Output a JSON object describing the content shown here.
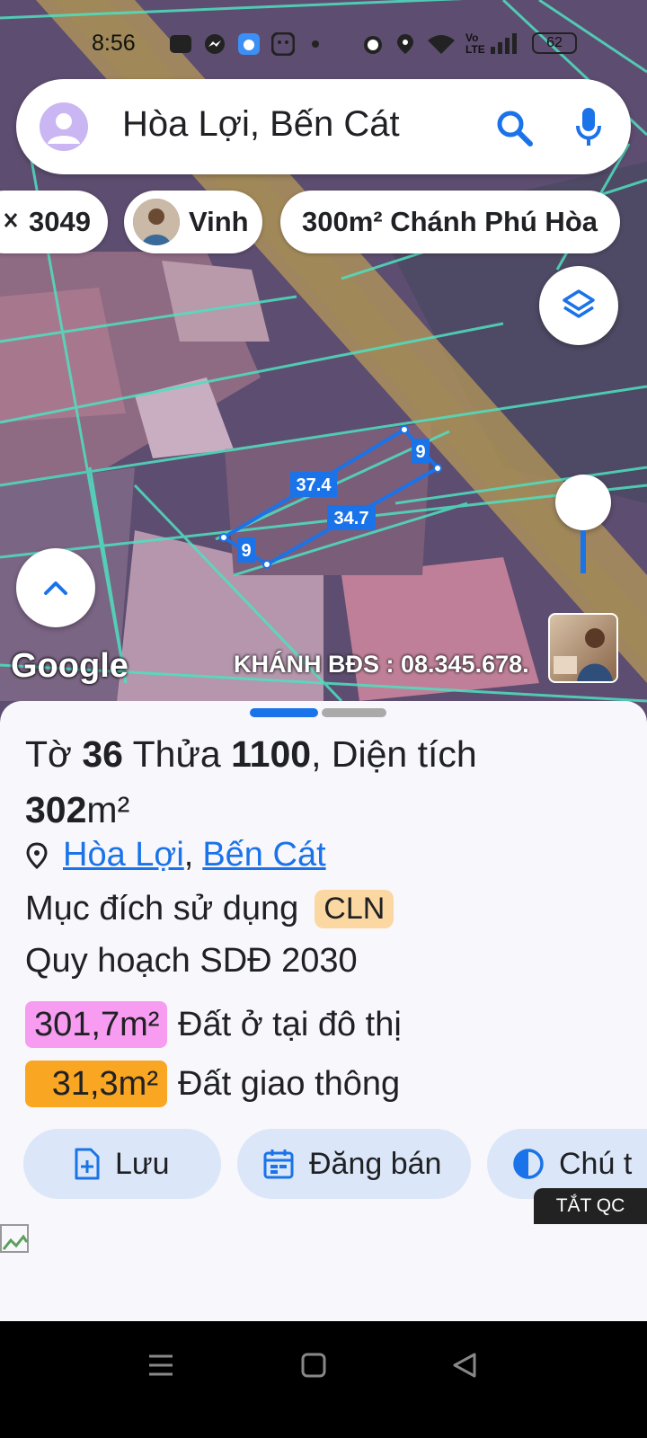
{
  "status_bar": {
    "time": "8:56",
    "battery": "62",
    "network": "Vo LTE"
  },
  "search": {
    "value": "Hòa Lợi, Bến Cát"
  },
  "chips": [
    {
      "label": "3049"
    },
    {
      "label": "Vinh"
    },
    {
      "label": "300m² Chánh Phú Hòa"
    }
  ],
  "map": {
    "google_label": "Google",
    "watermark": "KHÁNH BĐS : 08.345.678.",
    "edge_labels": {
      "top": "37.4",
      "bottom": "34.7",
      "right": "9",
      "left": "9"
    }
  },
  "parcel": {
    "to_label": "Tờ",
    "to_value": "36",
    "thua_label": "Thửa",
    "thua_value": "1100",
    "area_label": ", Diện tích",
    "area_value": "302",
    "area_unit": "m²",
    "location_ward": "Hòa Lợi",
    "location_sep": ",",
    "location_district": "Bến Cát",
    "purpose_label": "Mục đích sử dụng",
    "purpose_code": "CLN",
    "plan_label": "Quy hoạch SDĐ 2030",
    "land_uses": [
      {
        "area": "301,7m²",
        "type": "Đất ở tại đô thị",
        "color": "#f79cf0"
      },
      {
        "area": "31,3m²",
        "type": "Đất giao thông",
        "color": "#f9a623"
      }
    ]
  },
  "actions": {
    "save": "Lưu",
    "sell": "Đăng bán",
    "note": "Chú t"
  },
  "ad_off_label": "TẮT QC",
  "colors": {
    "accent": "#1a73e8",
    "button_bg": "#dbe7f8",
    "sheet_bg": "#f8f7fc"
  }
}
